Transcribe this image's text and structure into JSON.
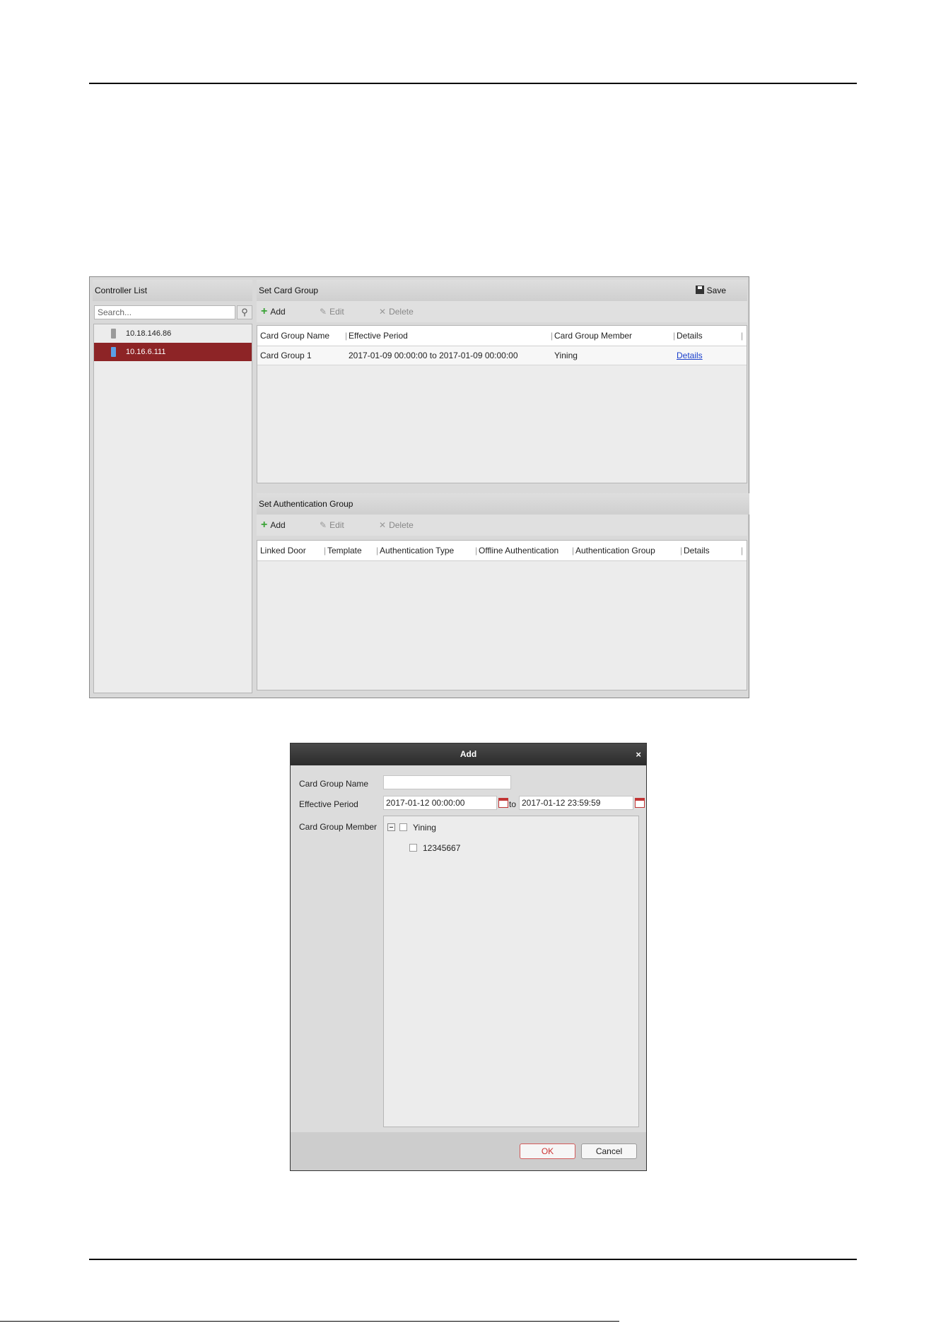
{
  "controller_panel": {
    "title": "Controller List",
    "search_placeholder": "Search...",
    "items": [
      {
        "label": "10.18.146.86",
        "selected": false
      },
      {
        "label": "10.16.6.111",
        "selected": true
      }
    ]
  },
  "card_group": {
    "title": "Set Card Group",
    "save_label": "Save",
    "toolbar": {
      "add": "Add",
      "edit": "Edit",
      "delete": "Delete"
    },
    "columns": [
      "Card Group Name",
      "Effective Period",
      "Card Group Member",
      "Details"
    ],
    "rows": [
      {
        "name": "Card Group 1",
        "period": "2017-01-09 00:00:00 to 2017-01-09 00:00:00",
        "member": "Yining",
        "details": "Details"
      }
    ]
  },
  "auth_group": {
    "title": "Set Authentication Group",
    "toolbar": {
      "add": "Add",
      "edit": "Edit",
      "delete": "Delete"
    },
    "columns": [
      "Linked Door",
      "Template",
      "Authentication Type",
      "Offline Authentication",
      "Authentication Group",
      "Details"
    ]
  },
  "dialog": {
    "title": "Add",
    "close": "×",
    "name_label": "Card Group Name",
    "name_value": "",
    "period_label": "Effective Period",
    "start": "2017-01-12 00:00:00",
    "to": "to",
    "end": "2017-01-12 23:59:59",
    "member_label": "Card Group Member",
    "tree": {
      "group": "Yining",
      "child": "12345667"
    },
    "ok": "OK",
    "cancel": "Cancel"
  },
  "colors": {
    "selected_row": "#8d2426",
    "link": "#1a3fcc",
    "add_icon": "#3aa336",
    "ok_border": "#d35b5b"
  }
}
